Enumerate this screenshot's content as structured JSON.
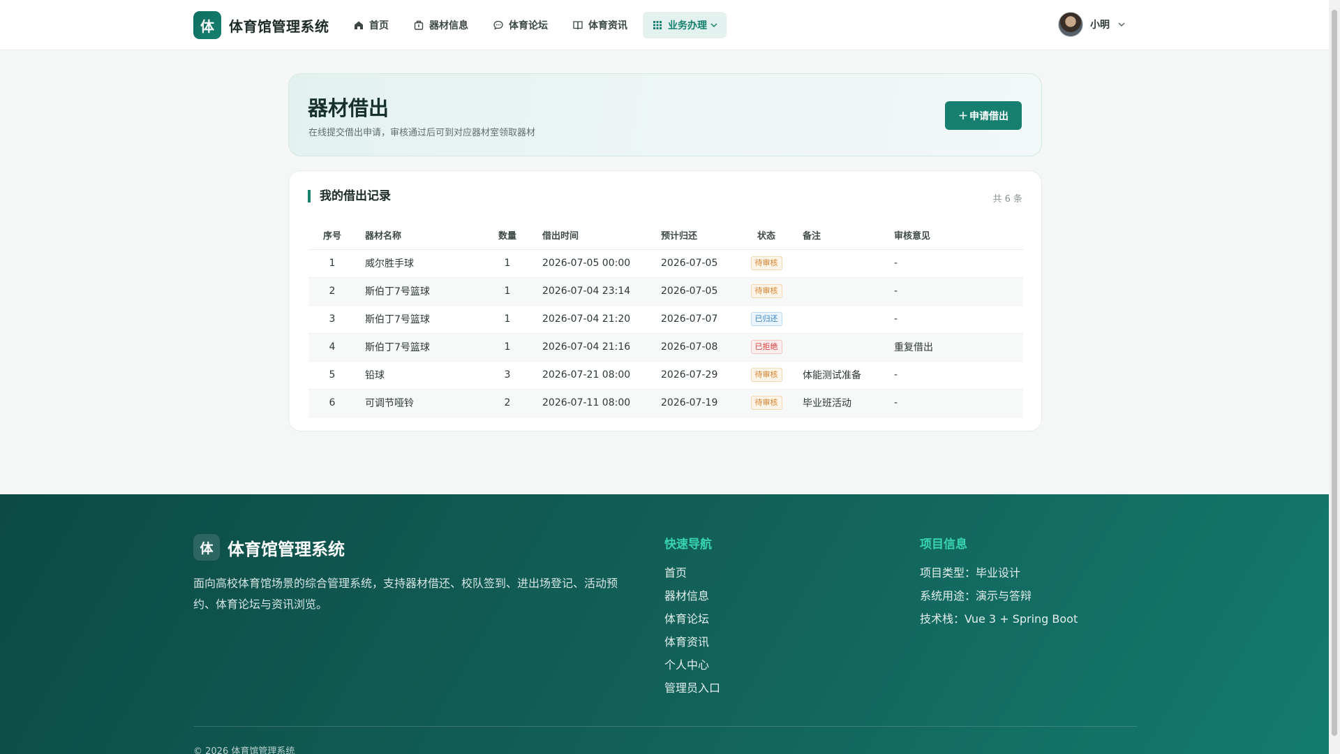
{
  "app": {
    "logo_char": "体",
    "title": "体育馆管理系统"
  },
  "nav": [
    {
      "label": "首页",
      "icon": "home-icon"
    },
    {
      "label": "器材信息",
      "icon": "equipment-icon"
    },
    {
      "label": "体育论坛",
      "icon": "chat-icon"
    },
    {
      "label": "体育资讯",
      "icon": "book-icon"
    },
    {
      "label": "业务办理",
      "icon": "grid-icon",
      "active": true
    }
  ],
  "user": {
    "name": "小明"
  },
  "hero": {
    "title": "器材借出",
    "subtitle": "在线提交借出申请，审核通过后可到对应器材室领取器材",
    "apply_button": "申请借出"
  },
  "records": {
    "title": "我的借出记录",
    "count_text": "共 6 条",
    "columns": [
      "序号",
      "器材名称",
      "数量",
      "借出时间",
      "预计归还",
      "状态",
      "备注",
      "审核意见"
    ],
    "rows": [
      {
        "idx": "1",
        "name": "威尔胜手球",
        "qty": "1",
        "time": "2026-07-05 00:00",
        "due": "2026-07-05",
        "status": "待审核",
        "status_type": "pending",
        "note": "",
        "review": "-"
      },
      {
        "idx": "2",
        "name": "斯伯丁7号篮球",
        "qty": "1",
        "time": "2026-07-04 23:14",
        "due": "2026-07-05",
        "status": "待审核",
        "status_type": "pending",
        "note": "",
        "review": "-"
      },
      {
        "idx": "3",
        "name": "斯伯丁7号篮球",
        "qty": "1",
        "time": "2026-07-04 21:20",
        "due": "2026-07-07",
        "status": "已归还",
        "status_type": "returned",
        "note": "",
        "review": "-"
      },
      {
        "idx": "4",
        "name": "斯伯丁7号篮球",
        "qty": "1",
        "time": "2026-07-04 21:16",
        "due": "2026-07-08",
        "status": "已拒绝",
        "status_type": "rejected",
        "note": "",
        "review": "重复借出"
      },
      {
        "idx": "5",
        "name": "铅球",
        "qty": "3",
        "time": "2026-07-21 08:00",
        "due": "2026-07-29",
        "status": "待审核",
        "status_type": "pending",
        "note": "体能测试准备",
        "review": "-"
      },
      {
        "idx": "6",
        "name": "可调节哑铃",
        "qty": "2",
        "time": "2026-07-11 08:00",
        "due": "2026-07-19",
        "status": "待审核",
        "status_type": "pending",
        "note": "毕业班活动",
        "review": "-"
      }
    ]
  },
  "footer": {
    "logo_char": "体",
    "title": "体育馆管理系统",
    "description": "面向高校体育馆场景的综合管理系统，支持器材借还、校队签到、进出场登记、活动预约、体育论坛与资讯浏览。",
    "quick_nav_title": "快速导航",
    "quick_nav": [
      "首页",
      "器材信息",
      "体育论坛",
      "体育资讯",
      "个人中心",
      "管理员入口"
    ],
    "project_title": "项目信息",
    "project_info": [
      "项目类型：毕业设计",
      "系统用途：演示与答辩",
      "技术栈：Vue 3 + Spring Boot"
    ],
    "copyright": "© 2026 体育馆管理系统"
  },
  "colors": {
    "primary": "#17806f",
    "footer_bg": "#12625a",
    "accent_text": "#37d3b2",
    "pending": "#d9822b",
    "returned": "#2f80c9",
    "rejected": "#d93a3a"
  }
}
